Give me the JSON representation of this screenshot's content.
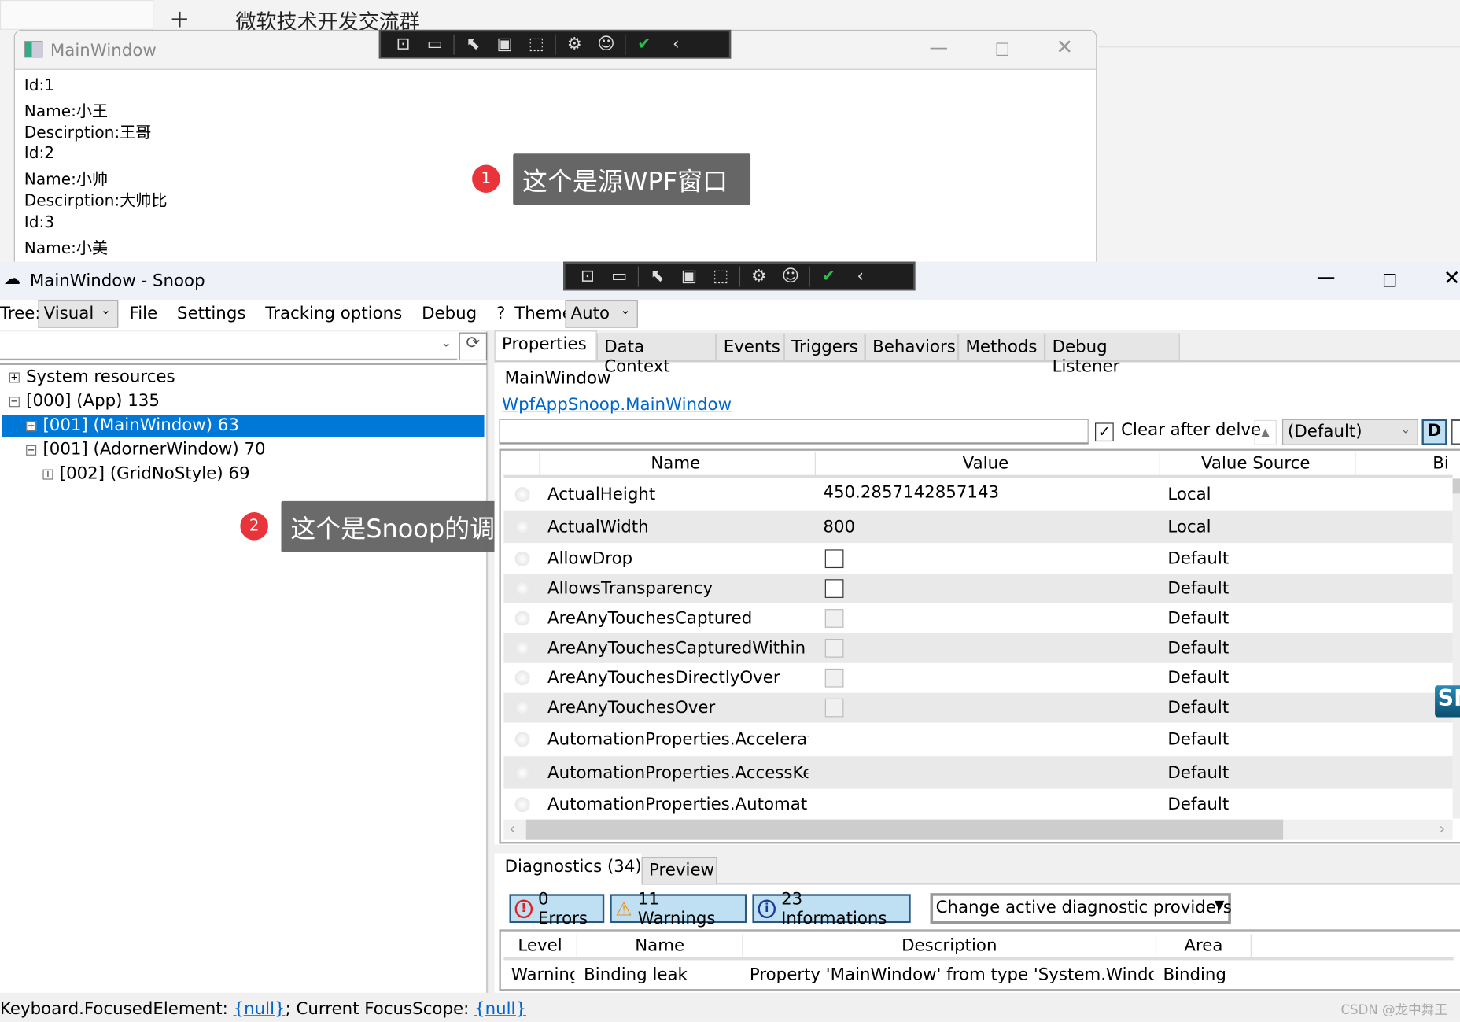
{
  "background": {
    "new_tab": "+",
    "group_title": "微软技术开发交流群"
  },
  "toolbar_icons": [
    "tree-select-icon",
    "record-icon",
    "pointer-select-icon",
    "frame-icon",
    "element-select-icon",
    "settings-gear-icon",
    "accessibility-icon",
    "check-icon",
    "collapse-chevron-icon"
  ],
  "source_window": {
    "title": "MainWindow",
    "lines": [
      "Id:1",
      "Name:小王",
      "Descirption:王哥",
      "Id:2",
      "Name:小帅",
      "Descirption:大帅比",
      "Id:3",
      "Name:小美"
    ]
  },
  "callouts": [
    {
      "num": "1",
      "text": "这个是源WPF窗口"
    },
    {
      "num": "2",
      "text": "这个是Snoop的调试窗口"
    }
  ],
  "snoop": {
    "title": "MainWindow - Snoop",
    "menu": {
      "tree_label": "Tree:",
      "tree_value": "Visual",
      "file": "File",
      "settings": "Settings",
      "tracking": "Tracking options",
      "debug": "Debug",
      "help": "?",
      "theme_label": "Theme:",
      "theme_value": "Auto"
    },
    "tree": [
      {
        "exp": "+",
        "label": "System resources"
      },
      {
        "exp": "−",
        "label": "[000]  (App) 135"
      },
      {
        "exp": "+",
        "label": "[001]  (MainWindow) 63",
        "selected": true
      },
      {
        "exp": "−",
        "label": "[001]  (AdornerWindow) 70"
      },
      {
        "exp": "+",
        "label": "[002]  (GridNoStyle) 69"
      }
    ],
    "tabs": [
      "Properties",
      "Data Context",
      "Events",
      "Triggers",
      "Behaviors",
      "Methods",
      "Debug Listener"
    ],
    "selected_name": "MainWindow",
    "selected_type_link": "WpfAppSnoop.MainWindow",
    "filter": {
      "value": "",
      "clear_after_delve": "Clear after delve",
      "clear_checked": true,
      "scope": "(Default)",
      "d_button": "D"
    },
    "columns": [
      "Name",
      "Value",
      "Value Source",
      "Bi"
    ],
    "properties": [
      {
        "name": "ActualHeight",
        "value": "450.2857142857143",
        "source": "Local"
      },
      {
        "name": "ActualWidth",
        "value": "800",
        "source": "Local"
      },
      {
        "name": "AllowDrop",
        "checkbox": "unchecked",
        "source": "Default"
      },
      {
        "name": "AllowsTransparency",
        "checkbox": "unchecked",
        "source": "Default"
      },
      {
        "name": "AreAnyTouchesCaptured",
        "checkbox": "disabled",
        "source": "Default"
      },
      {
        "name": "AreAnyTouchesCapturedWithin",
        "checkbox": "disabled",
        "source": "Default"
      },
      {
        "name": "AreAnyTouchesDirectlyOver",
        "checkbox": "disabled",
        "source": "Default"
      },
      {
        "name": "AreAnyTouchesOver",
        "checkbox": "disabled",
        "source": "Default"
      },
      {
        "name": "AutomationProperties.AcceleratorKey",
        "source": "Default"
      },
      {
        "name": "AutomationProperties.AccessKey",
        "source": "Default"
      },
      {
        "name": "AutomationProperties.AutomationId",
        "source": "Default"
      }
    ],
    "bottom_tabs": [
      "Diagnostics (34)",
      "Preview"
    ],
    "diag_buttons": {
      "errors": "0 Errors",
      "warnings": "11 Warnings",
      "infos": "23 Informations",
      "providers": "Change active diagnostic providers"
    },
    "diag_columns": [
      "Level",
      "Name",
      "Description",
      "Area"
    ],
    "diag_rows": [
      {
        "level": "Warning",
        "name": "Binding leak",
        "description": "Property 'MainWindow' from type 'System.Windows",
        "area": "Binding"
      }
    ],
    "status": {
      "focused_label": "Keyboard.FocusedElement: ",
      "focused_value": "{null}",
      "scope_label": "; Current FocusScope: ",
      "scope_value": "{null}"
    }
  },
  "watermark": "CSDN @龙中舞王",
  "colors": {
    "selection": "#0078d7",
    "callout_bg": "#666666",
    "badge": "#e8343a",
    "link": "#0066cc"
  }
}
